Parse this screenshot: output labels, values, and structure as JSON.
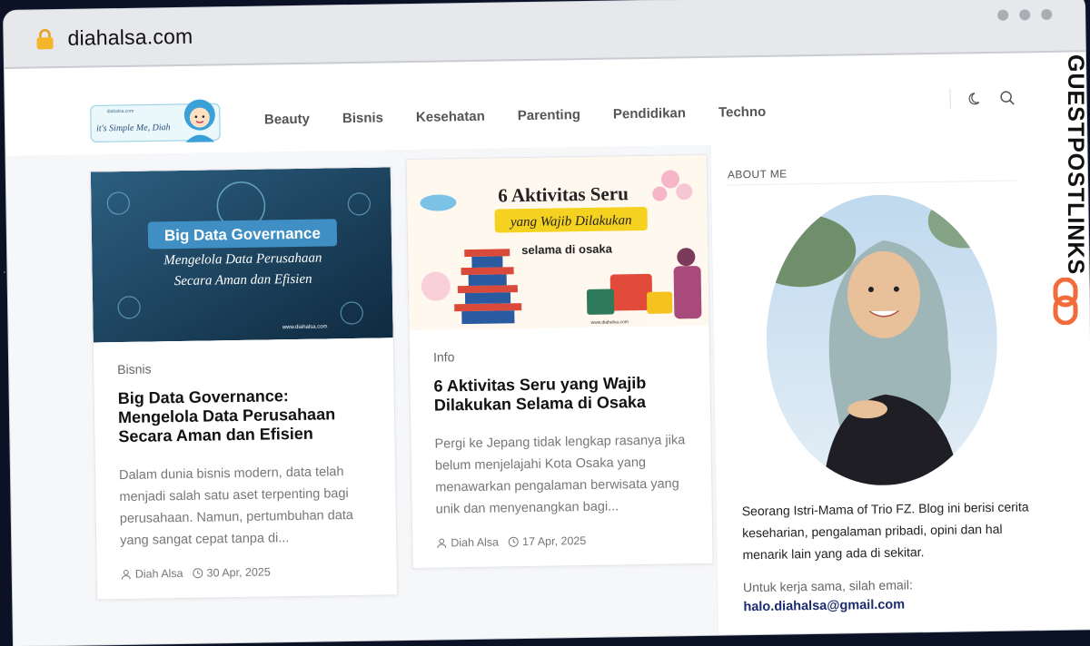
{
  "browser": {
    "url": "diahalsa.com"
  },
  "header": {
    "logo_small_text": "diahalsa.com",
    "logo_tagline": "it's Simple Me, Diah",
    "nav": [
      {
        "label": "Beauty"
      },
      {
        "label": "Bisnis"
      },
      {
        "label": "Kesehatan"
      },
      {
        "label": "Parenting"
      },
      {
        "label": "Pendidikan"
      },
      {
        "label": "Techno"
      }
    ]
  },
  "posts": [
    {
      "category": "Bisnis",
      "title": "Big Data Governance: Mengelola Data Perusahaan Secara Aman dan Efisien",
      "excerpt": "Dalam dunia bisnis modern, data telah menjadi salah satu aset terpenting bagi perusahaan. Namun, pertumbuhan data yang sangat cepat tanpa di...",
      "author": "Diah Alsa",
      "date": "30 Apr, 2025",
      "thumb_title": "Big Data Governance",
      "thumb_sub1": "Mengelola Data Perusahaan",
      "thumb_sub2": "Secara Aman dan Efisien",
      "thumb_site": "www.diahalsa.com"
    },
    {
      "category": "Info",
      "title": "6 Aktivitas Seru yang Wajib Dilakukan Selama di Osaka",
      "excerpt": "Pergi ke Jepang tidak lengkap rasanya jika belum menjelajahi Kota Osaka yang menawarkan pengalaman berwisata yang unik dan menyenangkan bagi...",
      "author": "Diah Alsa",
      "date": "17 Apr, 2025",
      "thumb_line1": "6 Aktivitas Seru",
      "thumb_line2": "yang Wajib Dilakukan",
      "thumb_line3": "selama di osaka",
      "thumb_site": "www.diahalsa.com"
    }
  ],
  "sidebar": {
    "about_label": "ABOUT ME",
    "bio": "Seorang Istri-Mama of Trio FZ. Blog ini berisi cerita keseharian, pengalaman pribadi, opini dan hal menarik lain yang ada di sekitar.",
    "collab_text": "Untuk kerja sama, silah email:",
    "email": "halo.diahalsa@gmail.com"
  },
  "watermark": {
    "text": "GUESTPOSTLINKS"
  },
  "colors": {
    "accent_email": "#1a2b6e",
    "watermark_orange": "#f26b3a"
  }
}
